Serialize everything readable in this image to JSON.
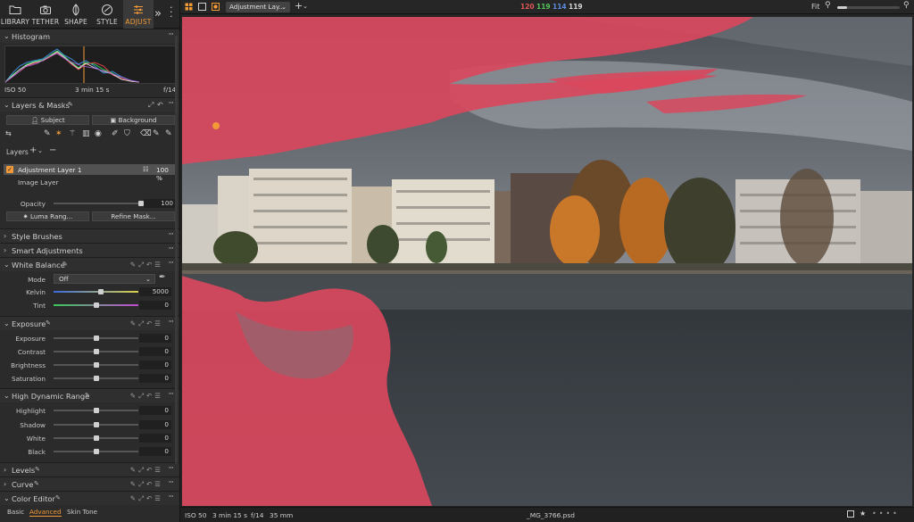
{
  "tool_tabs": [
    {
      "label": "LIBRARY",
      "icon": "folder-icon"
    },
    {
      "label": "TETHER",
      "icon": "camera-icon"
    },
    {
      "label": "SHAPE",
      "icon": "shape-icon"
    },
    {
      "label": "STYLE",
      "icon": "style-icon"
    },
    {
      "label": "ADJUST",
      "icon": "sliders-icon"
    }
  ],
  "active_tab": "ADJUST",
  "accent_color": "#f29a38",
  "histogram": {
    "title": "Histogram",
    "iso": "ISO 50",
    "shutter": "3 min 15 s",
    "aperture": "f/14"
  },
  "layers_masks": {
    "title": "Layers & Masks",
    "subject_label": "Subject",
    "background_label": "Background",
    "layers_label": "Layers",
    "selected_layer": "Adjustment Layer 1",
    "selected_opacity": "100 %",
    "image_layer": "Image Layer",
    "opacity_label": "Opacity",
    "opacity_value": "100",
    "luma_button": "Luma Rang...",
    "refine_button": "Refine Mask..."
  },
  "collapsed": {
    "style_brushes": "Style Brushes",
    "smart_adjustments": "Smart Adjustments"
  },
  "white_balance": {
    "title": "White Balance",
    "mode_label": "Mode",
    "mode_value": "Off",
    "kelvin_label": "Kelvin",
    "kelvin_value": "5000",
    "tint_label": "Tint",
    "tint_value": "0"
  },
  "exposure": {
    "title": "Exposure",
    "rows": [
      {
        "label": "Exposure",
        "value": "0"
      },
      {
        "label": "Contrast",
        "value": "0"
      },
      {
        "label": "Brightness",
        "value": "0"
      },
      {
        "label": "Saturation",
        "value": "0"
      }
    ]
  },
  "hdr": {
    "title": "High Dynamic Range",
    "rows": [
      {
        "label": "Highlight",
        "value": "0"
      },
      {
        "label": "Shadow",
        "value": "0"
      },
      {
        "label": "White",
        "value": "0"
      },
      {
        "label": "Black",
        "value": "0"
      }
    ]
  },
  "levels": "Levels",
  "curve": "Curve",
  "color_editor": {
    "title": "Color Editor",
    "tabs": [
      "Basic",
      "Advanced",
      "Skin Tone"
    ],
    "active": "Advanced"
  },
  "topbar": {
    "layer_dropdown": "Adjustment Lay...",
    "r": "120",
    "g": "119",
    "b": "114",
    "l": "119",
    "zoom_label": "Fit",
    "zoom_level": 0.15
  },
  "status": {
    "iso": "ISO 50",
    "shutter": "3 min 15 s",
    "aperture": "f/14",
    "focal": "35 mm",
    "filename": "_MG_3766.psd"
  }
}
